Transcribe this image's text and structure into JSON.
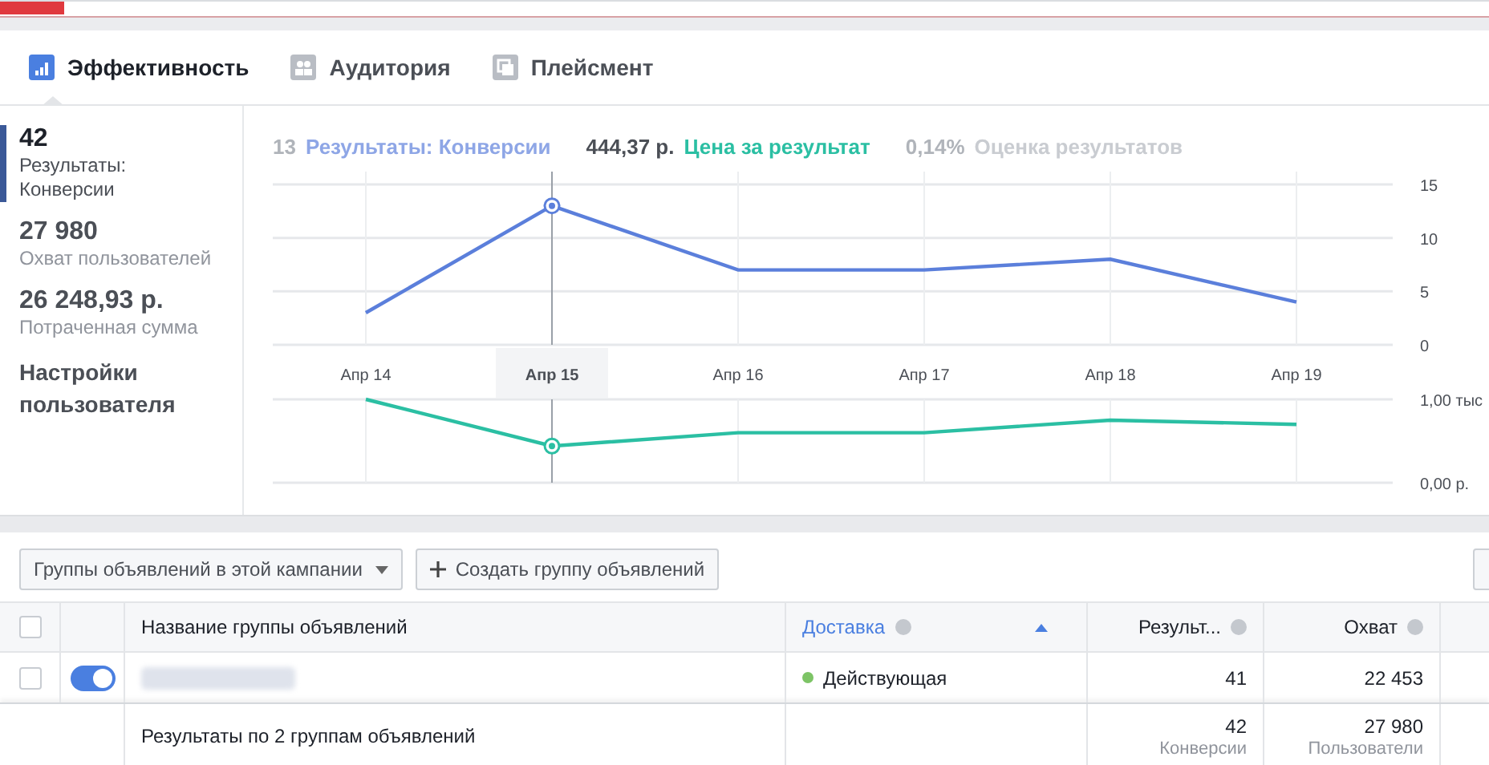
{
  "loading_bar": {
    "level": 0.043
  },
  "tabs": [
    {
      "label": "Эффективность",
      "selected": true
    },
    {
      "label": "Аудитория",
      "selected": false
    },
    {
      "label": "Плейсмент",
      "selected": false
    }
  ],
  "metrics": [
    {
      "kind": "stat",
      "value": "42",
      "label": "Результаты: Конверсии",
      "selected": true
    },
    {
      "kind": "stat",
      "value": "27 980",
      "label": "Охват пользователей",
      "selected": false
    },
    {
      "kind": "stat",
      "value": "26 248,93 р.",
      "label": "Потраченная сумма",
      "selected": false
    },
    {
      "kind": "link",
      "label": "Настройки пользователя",
      "selected": false
    }
  ],
  "legend": [
    {
      "amount": "13",
      "label": "Результаты: Конверсии",
      "color": "#8ea6e6",
      "selected": false
    },
    {
      "amount": "444,37 р.",
      "label": "Цена за результат",
      "color": "#2bbfa3",
      "selected": true
    },
    {
      "amount": "0,14%",
      "label": "Оценка результатов",
      "color": "#c9ccd1",
      "selected": false
    }
  ],
  "charts": [
    {
      "chart_data": {
        "type": "line",
        "categories": [
          "Апр 14",
          "Апр 15",
          "Апр 16",
          "Апр 17",
          "Апр 18",
          "Апр 19"
        ],
        "series": [
          {
            "color": "#5b7fdb",
            "values": [
              3,
              13,
              7,
              7,
              8,
              4
            ]
          }
        ],
        "ylim": [
          0,
          15
        ],
        "yticks": [
          0,
          5,
          10,
          15
        ],
        "grid": true,
        "ref_lines": [
          {
            "axis": "x",
            "value": "Апр 15"
          }
        ]
      }
    },
    {
      "chart_data": {
        "type": "line",
        "series": [
          {
            "color": "#2bbfa3",
            "values": [
              1.0,
              0.44,
              0.6,
              0.6,
              0.75,
              0.7
            ]
          }
        ],
        "ylim": [
          0,
          1
        ],
        "yticks": [
          {
            "value": 0,
            "label": "0,00 р."
          },
          {
            "value": 1,
            "label": "1,00 тыс"
          }
        ],
        "grid": true
      }
    }
  ],
  "toolbar": {
    "dropdown": "Группы объявлений в этой кампании",
    "create_button": "Создать группу объявлений"
  },
  "table": {
    "select_all_checked": false,
    "columns": [
      {
        "label": "Название группы объявлений",
        "info": false,
        "sorted": false
      },
      {
        "label": "Доставка",
        "info": true,
        "sorted": true
      },
      {
        "label": "Результ...",
        "info": true,
        "sorted": false
      },
      {
        "label": "Охват",
        "info": true,
        "sorted": false
      }
    ],
    "rows": [
      {
        "checked": false,
        "on": true,
        "delivery": "Действующая",
        "color": "#7dc466",
        "results": "41",
        "reach": "22 453"
      }
    ],
    "footer": {
      "label": "Результаты по 2 группам объявлений",
      "results": "42",
      "results_unit": "Конверсии",
      "reach": "27 980",
      "reach_unit": "Пользователи"
    }
  }
}
